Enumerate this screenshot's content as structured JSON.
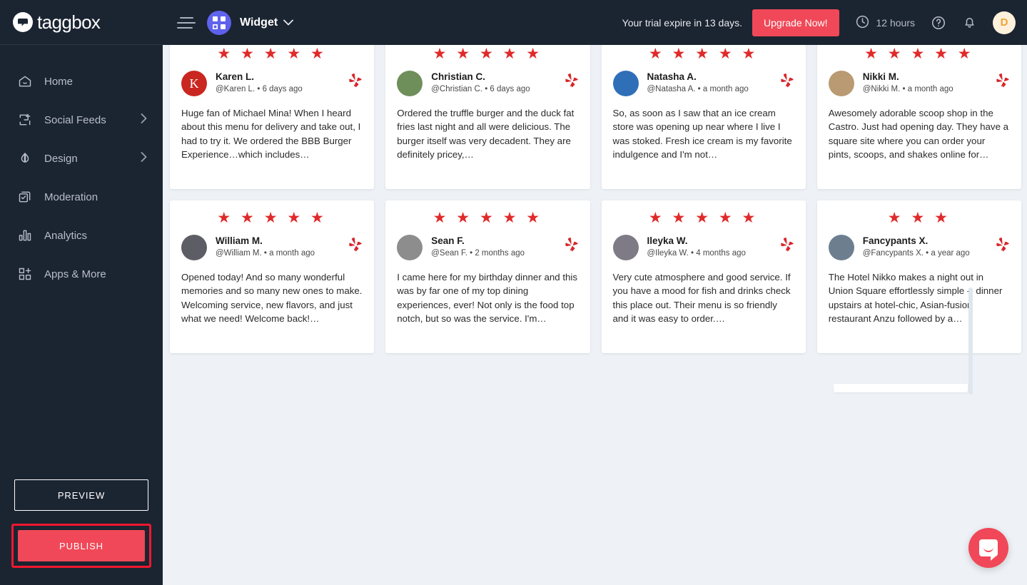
{
  "brand": {
    "name": "taggbox",
    "logo_icon": "taggbox-logo-icon"
  },
  "sidebar": {
    "items": [
      {
        "label": "Home",
        "icon": "home-icon",
        "chevron": ""
      },
      {
        "label": "Social Feeds",
        "icon": "add-feed-icon",
        "chevron": "›"
      },
      {
        "label": "Design",
        "icon": "droplet-icon",
        "chevron": "›"
      },
      {
        "label": "Moderation",
        "icon": "moderation-icon",
        "chevron": ""
      },
      {
        "label": "Analytics",
        "icon": "bar-chart-icon",
        "chevron": ""
      },
      {
        "label": "Apps & More",
        "icon": "apps-grid-icon",
        "chevron": ""
      }
    ],
    "preview_label": "PREVIEW",
    "publish_label": "PUBLISH",
    "publish_highlight_color": "#f2182f",
    "publish_color": "#f04858"
  },
  "topbar": {
    "menu_icon": "hamburger-icon",
    "widget_icon": "widget-grid-icon",
    "widget_name": "Widget",
    "widget_chevron_icon": "chevron-down-icon",
    "trial_text": "Your trial expire in 13 days.",
    "upgrade_label": "Upgrade Now!",
    "upgrade_color": "#f04858",
    "hours_icon": "clock-icon",
    "hours_text": "12 hours",
    "help_icon": "help-circle-icon",
    "notification_icon": "bell-icon",
    "avatar_initial": "D",
    "avatar_bg": "#fdf1dd",
    "avatar_fg": "#f0a233"
  },
  "reviews": [
    {
      "rating": 5,
      "name": "Karen L.",
      "handle": "@Karen L.",
      "time": "6 days ago",
      "text": "Huge fan of Michael Mina! When I heard about this menu for delivery and take out, I had to try it. We ordered the BBB Burger Experience…which includes…",
      "source_icon": "yelp-icon",
      "avatar_kind": "initial",
      "avatar_initial": "K",
      "avatar_bg": "#c9271f"
    },
    {
      "rating": 5,
      "name": "Christian C.",
      "handle": "@Christian C.",
      "time": "6 days ago",
      "text": "Ordered the truffle burger and the duck fat fries last night and all were delicious. The burger itself was very decadent. They are definitely pricey,…",
      "source_icon": "yelp-icon",
      "avatar_kind": "photo",
      "avatar_initial": "",
      "avatar_bg": "#6f8f5a"
    },
    {
      "rating": 5,
      "name": "Natasha A.",
      "handle": "@Natasha A.",
      "time": "a month ago",
      "text": "So, as soon as I saw that an ice cream store was opening up near where I live I was stoked. Fresh ice cream is my favorite indulgence and I'm not…",
      "source_icon": "yelp-icon",
      "avatar_kind": "photo",
      "avatar_initial": "",
      "avatar_bg": "#2f6fb8"
    },
    {
      "rating": 5,
      "name": "Nikki M.",
      "handle": "@Nikki M.",
      "time": "a month ago",
      "text": "Awesomely adorable scoop shop in the Castro. Just had opening day. They have a square site where you can order your pints, scoops, and shakes online for…",
      "source_icon": "yelp-icon",
      "avatar_kind": "photo",
      "avatar_initial": "",
      "avatar_bg": "#b99a72"
    },
    {
      "rating": 5,
      "name": "William M.",
      "handle": "@William M.",
      "time": "a month ago",
      "text": "Opened today! And so many wonderful memories and so many new ones to make. Welcoming service, new flavors, and just what we need! Welcome back!…",
      "source_icon": "yelp-icon",
      "avatar_kind": "photo",
      "avatar_initial": "",
      "avatar_bg": "#5d5d66"
    },
    {
      "rating": 5,
      "name": "Sean F.",
      "handle": "@Sean F.",
      "time": "2 months ago",
      "text": "I came here for my birthday dinner and this was by far one of my top dining experiences, ever! Not only is the food top notch, but so was the service. I'm…",
      "source_icon": "yelp-icon",
      "avatar_kind": "photo",
      "avatar_initial": "",
      "avatar_bg": "#8d8d8d"
    },
    {
      "rating": 5,
      "name": "Ileyka W.",
      "handle": "@Ileyka W.",
      "time": "4 months ago",
      "text": "Very cute atmosphere and good service. If you have a mood for fish and drinks check this place out. Their menu is so friendly and it was easy to order.…",
      "source_icon": "yelp-icon",
      "avatar_kind": "photo",
      "avatar_initial": "",
      "avatar_bg": "#7e7a86"
    },
    {
      "rating": 3,
      "name": "Fancypants X.",
      "handle": "@Fancypants X.",
      "time": "a year ago",
      "text": "The Hotel Nikko makes a night out in Union Square effortlessly simple -- dinner upstairs at hotel-chic, Asian-fusion restaurant Anzu followed by a…",
      "source_icon": "yelp-icon",
      "avatar_kind": "photo",
      "avatar_initial": "",
      "avatar_bg": "#6d7f8f"
    }
  ],
  "chat": {
    "icon": "intercom-chat-icon",
    "color": "#f04858"
  },
  "theme": {
    "star_color": "#e02a2a",
    "background": "#eef2f6",
    "sidebar_bg": "#1b2431"
  }
}
